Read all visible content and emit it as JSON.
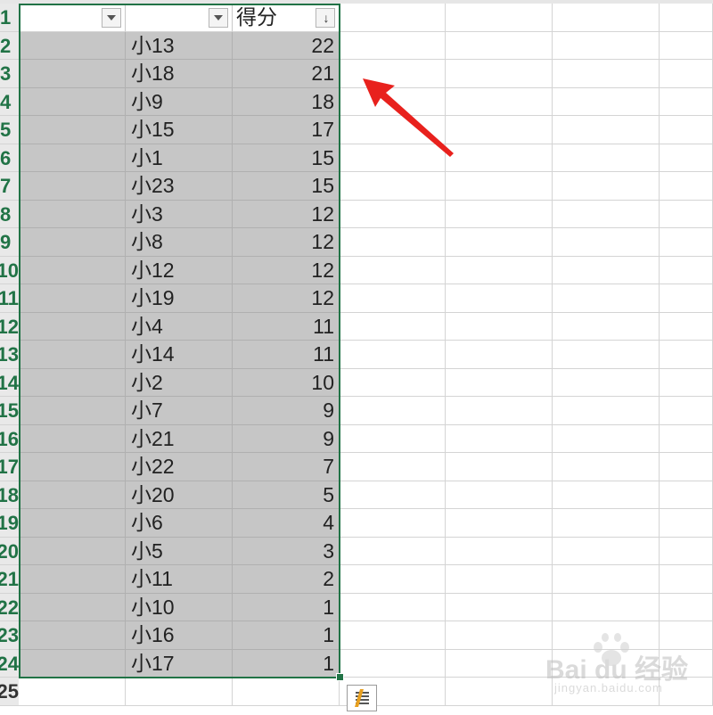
{
  "columns": {
    "a_header": "",
    "b_header": "",
    "c_header": "得分"
  },
  "rows": [
    {
      "row": "2",
      "name": "小13",
      "score": "22"
    },
    {
      "row": "3",
      "name": "小18",
      "score": "21"
    },
    {
      "row": "4",
      "name": "小9",
      "score": "18"
    },
    {
      "row": "5",
      "name": "小15",
      "score": "17"
    },
    {
      "row": "6",
      "name": "小1",
      "score": "15"
    },
    {
      "row": "7",
      "name": "小23",
      "score": "15"
    },
    {
      "row": "8",
      "name": "小3",
      "score": "12"
    },
    {
      "row": "9",
      "name": "小8",
      "score": "12"
    },
    {
      "row": "10",
      "name": "小12",
      "score": "12"
    },
    {
      "row": "11",
      "name": "小19",
      "score": "12"
    },
    {
      "row": "12",
      "name": "小4",
      "score": "11"
    },
    {
      "row": "13",
      "name": "小14",
      "score": "11"
    },
    {
      "row": "14",
      "name": "小2",
      "score": "10"
    },
    {
      "row": "15",
      "name": "小7",
      "score": "9"
    },
    {
      "row": "16",
      "name": "小21",
      "score": "9"
    },
    {
      "row": "17",
      "name": "小22",
      "score": "7"
    },
    {
      "row": "18",
      "name": "小20",
      "score": "5"
    },
    {
      "row": "19",
      "name": "小6",
      "score": "4"
    },
    {
      "row": "20",
      "name": "小5",
      "score": "3"
    },
    {
      "row": "21",
      "name": "小11",
      "score": "2"
    },
    {
      "row": "22",
      "name": "小10",
      "score": "1"
    },
    {
      "row": "23",
      "name": "小16",
      "score": "1"
    },
    {
      "row": "24",
      "name": "小17",
      "score": "1"
    }
  ],
  "header_row_number": "1",
  "empty_rows": [
    "25"
  ],
  "icons": {
    "filter": "filter-dropdown-icon",
    "sort": "sort-descending-icon",
    "quick_analysis": "quick-analysis-icon",
    "arrow": "red-annotation-arrow"
  },
  "colors": {
    "selection_border": "#217346",
    "selection_fill": "#c6c6c6",
    "arrow": "#e8211d",
    "gridline": "#d4d4d4"
  },
  "watermark": {
    "main": "Bai du 经验",
    "sub": "jingyan.baidu.com"
  }
}
